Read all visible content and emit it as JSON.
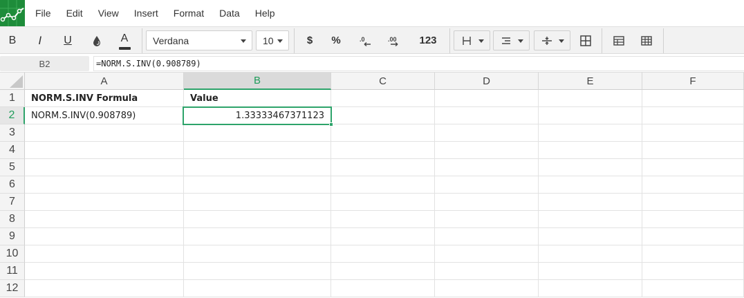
{
  "menu": [
    "File",
    "Edit",
    "View",
    "Insert",
    "Format",
    "Data",
    "Help"
  ],
  "toolbar": {
    "bold": "B",
    "italic": "I",
    "underline": "U",
    "font_color_glyph": "A",
    "font_name": "Verdana",
    "font_size": "10",
    "currency": "$",
    "percent": "%",
    "number_format": "123"
  },
  "formula_bar": {
    "cell_ref": "B2",
    "formula": "=NORM.S.INV(0.908789)"
  },
  "columns": [
    "A",
    "B",
    "C",
    "D",
    "E",
    "F"
  ],
  "selected_column": "B",
  "rows": [
    "1",
    "2",
    "3",
    "4",
    "5",
    "6",
    "7",
    "8",
    "9",
    "10",
    "11",
    "12"
  ],
  "selected_row": "2",
  "cells": {
    "A1": "NORM.S.INV Formula",
    "B1": "Value",
    "A2": "NORM.S.INV(0.908789)",
    "B2": "1.33333467371123"
  },
  "colors": {
    "accent": "#2da36a",
    "logo": "#1e8c3a"
  }
}
